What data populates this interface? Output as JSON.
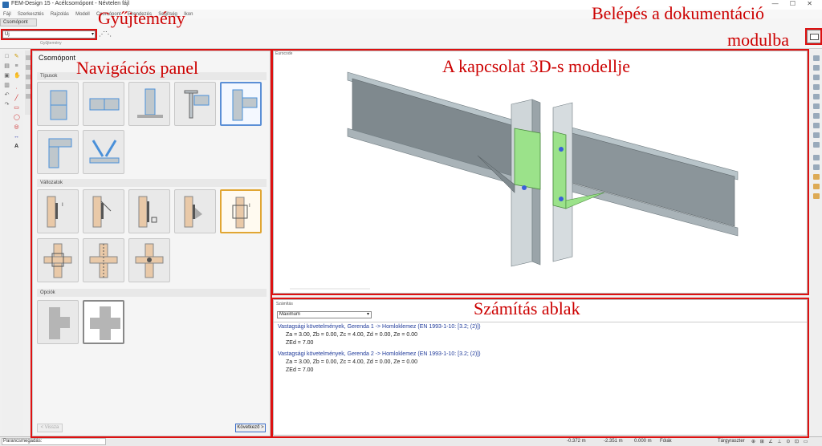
{
  "titlebar": {
    "title": "FEM-Design 15 - Acélcsomópont - Névtelen fájl"
  },
  "menu": [
    "Fájl",
    "Szerkesztés",
    "Rajzolás",
    "Modell",
    "Csomópont",
    "Elrendezés",
    "Segítség",
    "Ikon"
  ],
  "ribbon": {
    "tab": "Csomópont",
    "combo_value": "Új",
    "group_label": "Gyűjtemény"
  },
  "nav": {
    "title": "Csomópont",
    "sections": {
      "types": "Típusok",
      "variants": "Változatok",
      "options": "Opciók"
    },
    "back": "< Vissza",
    "next": "Következő >"
  },
  "view": {
    "caption": "Eurocode"
  },
  "calc": {
    "caption": "Számítás",
    "dropdown": "Maximum",
    "line1": "Vastagsági követelmények, Gerenda 1 -> Homloklemez (EN 1993-1-10: [3.2; (2)])",
    "line1b": "Za = 3.00, Zb = 0.00, Zc = 4.00, Zd = 0.00, Ze = 0.00",
    "line1c": "ZEd = 7.00",
    "line2": "Vastagsági követelmények, Gerenda 2 -> Homloklemez (EN 1993-1-10: [3.2; (2)])",
    "line2b": "Za = 3.00, Zb = 0.00, Zc = 4.00, Zd = 0.00, Ze = 0.00",
    "line2c": "ZEd = 7.00"
  },
  "status": {
    "command": "Parancsmegadás:",
    "x": "-0.372 m",
    "y": "-2.351 m",
    "z": "0.000 m",
    "mode": "Fólák",
    "snap": "Tárgyraszter"
  },
  "annotations": {
    "collection": "Gyűjtemény",
    "doc1": "Belépés a dokumentáció",
    "doc2": "modulba",
    "nav": "Navigációs panel",
    "model": "A kapcsolat 3D-s modellje",
    "calc": "Számítás ablak"
  },
  "colors": {
    "accent_red": "#d11111",
    "beam": "#8d979c",
    "plate": "#9be28a",
    "bolt": "#3a5fd9"
  }
}
